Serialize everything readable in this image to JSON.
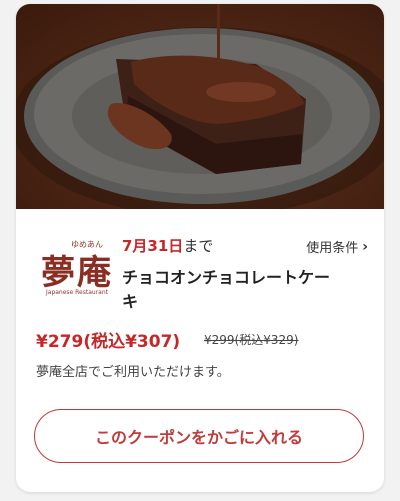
{
  "coupon": {
    "expiry_date": "7月31日",
    "expiry_suffix": "まで",
    "terms_label": "使用条件",
    "terms_icon": "chevron-right-icon",
    "product_name": "チョコオンチョコレートケーキ",
    "price": "¥279(税込¥307)",
    "original_price": "¥299(税込¥329)",
    "availability_note": "夢庵全店でご利用いただけます。",
    "cta_label": "このクーポンをかごに入れる"
  },
  "brand": {
    "logo_name": "夢庵",
    "logo_kana": "ゆめあん",
    "logo_sub": "Japanese Restaurant"
  },
  "colors": {
    "accent_red": "#c62828",
    "brand_brown": "#8a2e24"
  }
}
